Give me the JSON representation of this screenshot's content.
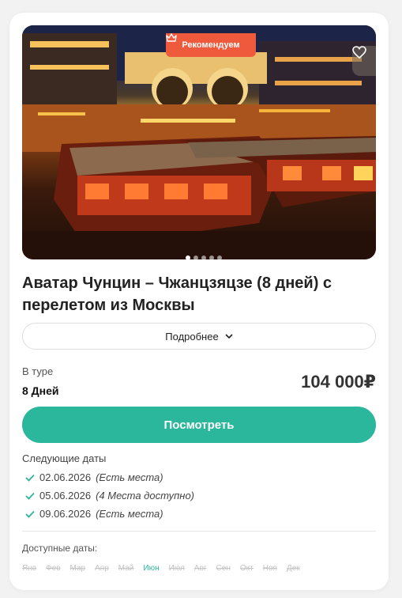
{
  "badge": {
    "label": "Рекомендуем",
    "icon": "crown-icon",
    "color": "#ef5a3c"
  },
  "favorite": {
    "icon": "heart-icon"
  },
  "gallery": {
    "slides": 5,
    "active_index": 0
  },
  "title": "Аватар Чунцин – Чжанцзяцзе (8 дней) с перелетом из Москвы",
  "details_button": {
    "label": "Подробнее",
    "icon": "chevron-down-icon"
  },
  "tour": {
    "label": "В туре",
    "days": "8 Дней"
  },
  "price": "104 000₽",
  "view_button": {
    "label": "Посмотреть",
    "color": "#2bb79b"
  },
  "next_dates": {
    "label": "Следующие даты",
    "items": [
      {
        "date": "02.06.2026",
        "availability": "(Есть места)"
      },
      {
        "date": "05.06.2026",
        "availability": "(4 Места доступно)"
      },
      {
        "date": "09.06.2026",
        "availability": "(Есть места)"
      }
    ]
  },
  "available_months": {
    "label": "Доступные даты:",
    "months": [
      "Янв",
      "Фев",
      "Мар",
      "Апр",
      "Май",
      "Июн",
      "Июл",
      "Авг",
      "Сен",
      "Окт",
      "Ноя",
      "Дек"
    ],
    "active": "Июн"
  }
}
